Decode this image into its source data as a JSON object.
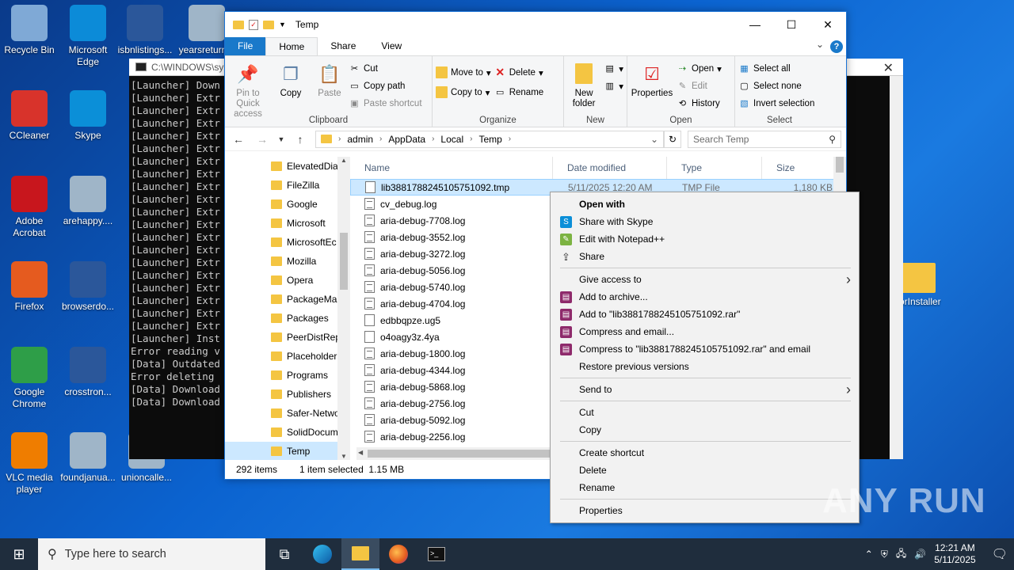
{
  "desktop": {
    "icons": [
      {
        "label": "Recycle Bin",
        "icon": "recycle-bin-icon",
        "color": "#7fa9d6"
      },
      {
        "label": "Microsoft Edge",
        "icon": "edge-icon",
        "color": "#0c8bd8"
      },
      {
        "label": "isbnlistings...",
        "icon": "word-doc-icon",
        "color": "#2b579a"
      },
      {
        "label": "yearsreturn...",
        "icon": "image-file-icon",
        "color": "#9fb5c8"
      },
      {
        "label": "CCleaner",
        "icon": "ccleaner-icon",
        "color": "#d8332b"
      },
      {
        "label": "Skype",
        "icon": "skype-icon",
        "color": "#0b8fd8"
      },
      {
        "label": "Adobe Acrobat",
        "icon": "acrobat-icon",
        "color": "#c8161d"
      },
      {
        "label": "arehappy....",
        "icon": "image-file-icon",
        "color": "#9fb5c8"
      },
      {
        "label": "Firefox",
        "icon": "firefox-icon",
        "color": "#e55b1f"
      },
      {
        "label": "browserdo...",
        "icon": "word-doc-icon",
        "color": "#2b579a"
      },
      {
        "label": "Google Chrome",
        "icon": "chrome-icon",
        "color": "#2e9e48"
      },
      {
        "label": "crosstron...",
        "icon": "word-doc-icon",
        "color": "#2b579a"
      },
      {
        "label": "VLC media player",
        "icon": "vlc-icon",
        "color": "#ef7d00"
      },
      {
        "label": "foundjanua...",
        "icon": "image-file-icon",
        "color": "#9fb5c8"
      },
      {
        "label": "unioncalle...",
        "icon": "image-file-icon",
        "color": "#9fb5c8"
      },
      {
        "label": "porInstaller",
        "icon": "folder-icon",
        "color": "#f4c542"
      }
    ]
  },
  "console": {
    "title": "C:\\WINDOWS\\sy",
    "lines": [
      "[Launcher] Down",
      "[Launcher] Extr",
      "[Launcher] Extr",
      "[Launcher] Extr",
      "[Launcher] Extr",
      "[Launcher] Extr",
      "[Launcher] Extr",
      "[Launcher] Extr",
      "[Launcher] Extr",
      "[Launcher] Extr",
      "[Launcher] Extr",
      "[Launcher] Extr",
      "[Launcher] Extr",
      "[Launcher] Extr",
      "[Launcher] Extr",
      "[Launcher] Extr",
      "[Launcher] Extr",
      "[Launcher] Extr",
      "[Launcher] Extr",
      "[Launcher] Extr",
      "[Launcher] Inst",
      "Error reading v",
      "[Data] Outdated",
      "Error deleting",
      "[Data] Download",
      "[Data] Download"
    ]
  },
  "explorer": {
    "title": "Temp",
    "tabs": {
      "file": "File",
      "home": "Home",
      "share": "Share",
      "view": "View"
    },
    "ribbon": {
      "pin": "Pin to Quick access",
      "copy": "Copy",
      "paste": "Paste",
      "cut": "Cut",
      "copy_path": "Copy path",
      "paste_shortcut": "Paste shortcut",
      "clipboard": "Clipboard",
      "move_to": "Move to",
      "copy_to": "Copy to",
      "delete": "Delete",
      "rename": "Rename",
      "organize": "Organize",
      "new_folder": "New folder",
      "new": "New",
      "properties": "Properties",
      "open": "Open",
      "edit": "Edit",
      "history": "History",
      "open_group": "Open",
      "select_all": "Select all",
      "select_none": "Select none",
      "invert_selection": "Invert selection",
      "select": "Select"
    },
    "address": [
      "admin",
      "AppData",
      "Local",
      "Temp"
    ],
    "search_placeholder": "Search Temp",
    "nav_items": [
      "ElevatedDia",
      "FileZilla",
      "Google",
      "Microsoft",
      "MicrosoftEc",
      "Mozilla",
      "Opera",
      "PackageMa",
      "Packages",
      "PeerDistRep",
      "Placeholder",
      "Programs",
      "Publishers",
      "Safer-Netwo",
      "SolidDocum",
      "Temp"
    ],
    "columns": {
      "name": "Name",
      "date": "Date modified",
      "type": "Type",
      "size": "Size"
    },
    "files": [
      {
        "name": "lib3881788245105751092.tmp",
        "date": "5/11/2025 12:20 AM",
        "type": "TMP File",
        "size": "1,180 KB"
      },
      {
        "name": "cv_debug.log"
      },
      {
        "name": "aria-debug-7708.log"
      },
      {
        "name": "aria-debug-3552.log"
      },
      {
        "name": "aria-debug-3272.log"
      },
      {
        "name": "aria-debug-5056.log"
      },
      {
        "name": "aria-debug-5740.log"
      },
      {
        "name": "aria-debug-4704.log"
      },
      {
        "name": "edbbqpze.ug5"
      },
      {
        "name": "o4oagy3z.4ya"
      },
      {
        "name": "aria-debug-1800.log"
      },
      {
        "name": "aria-debug-4344.log"
      },
      {
        "name": "aria-debug-5868.log"
      },
      {
        "name": "aria-debug-2756.log"
      },
      {
        "name": "aria-debug-5092.log"
      },
      {
        "name": "aria-debug-2256.log"
      }
    ],
    "status": {
      "count": "292 items",
      "selected": "1 item selected",
      "size": "1.15 MB"
    }
  },
  "context_menu": {
    "groups": [
      [
        {
          "label": "Open with",
          "icon": "",
          "bold": true
        },
        {
          "label": "Share with Skype",
          "icon": "skype-icon"
        },
        {
          "label": "Edit with Notepad++",
          "icon": "notepadpp-icon"
        },
        {
          "label": "Share",
          "icon": "share-icon"
        }
      ],
      [
        {
          "label": "Give access to",
          "submenu": true
        },
        {
          "label": "Add to archive...",
          "icon": "winrar-icon"
        },
        {
          "label": "Add to \"lib3881788245105751092.rar\"",
          "icon": "winrar-icon"
        },
        {
          "label": "Compress and email...",
          "icon": "winrar-icon"
        },
        {
          "label": "Compress to \"lib3881788245105751092.rar\" and email",
          "icon": "winrar-icon"
        },
        {
          "label": "Restore previous versions"
        }
      ],
      [
        {
          "label": "Send to",
          "submenu": true
        }
      ],
      [
        {
          "label": "Cut"
        },
        {
          "label": "Copy"
        }
      ],
      [
        {
          "label": "Create shortcut"
        },
        {
          "label": "Delete"
        },
        {
          "label": "Rename"
        }
      ],
      [
        {
          "label": "Properties"
        }
      ]
    ]
  },
  "watermark": "ANY RUN",
  "taskbar": {
    "search_placeholder": "Type here to search",
    "time": "12:21 AM",
    "date": "5/11/2025"
  }
}
